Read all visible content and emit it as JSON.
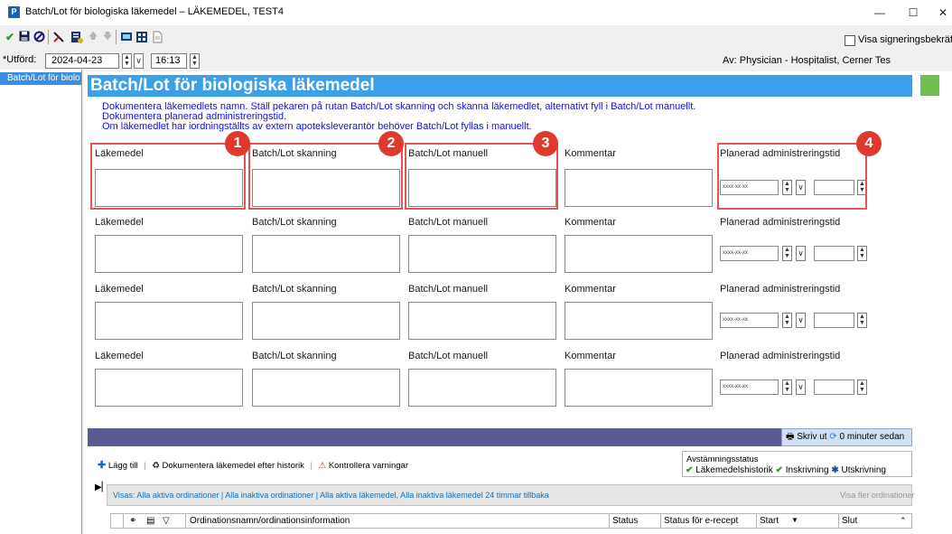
{
  "window": {
    "app_icon": "P",
    "title": "Batch/Lot för biologiska läkemedel – LÄKEMEDEL, TEST4"
  },
  "toolbar": {
    "icons": [
      "checkmark-icon",
      "save-icon",
      "cancel-icon",
      "tools-icon",
      "document-icon",
      "up-arrow-icon",
      "down-arrow-icon",
      "monitor-icon",
      "calculator-icon",
      "page-icon"
    ],
    "signing_label": "Visa signeringsbekräftels"
  },
  "performed": {
    "label": "*Utförd:",
    "date": "2024-04-23",
    "time": "16:13"
  },
  "author": {
    "text": "Av:  Physician - Hospitalist, Cerner Tes"
  },
  "sidebar": {
    "item": "Batch/Lot för biolo"
  },
  "form": {
    "title": "Batch/Lot för biologiska läkemedel",
    "instructions": [
      "Dokumentera läkemedlets namn. Ställ pekaren på rutan Batch/Lot skanning och skanna läkemedlet, alternativt fyll i Batch/Lot manuellt.",
      "Dokumentera planerad administreringstid.",
      "Om läkemedlet har iordningställts av extern apoteksleverantör behöver Batch/Lot fyllas i manuellt."
    ],
    "labels": {
      "drug": "Läkemedel",
      "scan": "Batch/Lot skanning",
      "manual": "Batch/Lot manuell",
      "comment": "Kommentar",
      "planned": "Planerad administreringstid"
    },
    "date_placeholder": "xxxx-xx-xx",
    "badges": [
      "1",
      "2",
      "3",
      "4"
    ]
  },
  "bottom": {
    "print_label": "Skriv ut",
    "refresh_label": "0 minuter sedan",
    "add_label": "Lägg till",
    "history_label": "Dokumentera läkemedel efter historik",
    "check_label": "Kontrollera varningar",
    "recon_title": "Avstämningsstatus",
    "recon_history": "Läkemedelshistorik",
    "recon_admission": "Inskrivning",
    "recon_discharge": "Utskrivning",
    "filter_text": "Visas: Alla aktiva ordinationer | Alla inaktiva ordinationer | Alla aktiva läkemedel, Alla inaktiva läkemedel 24 timmar tillbaka",
    "more_orders": "Visa fler ordinationer",
    "columns": {
      "order": "Ordinationsnamn/ordinationsinformation",
      "status": "Status",
      "erecept": "Status för e-recept",
      "start": "Start",
      "end": "Slut"
    }
  }
}
